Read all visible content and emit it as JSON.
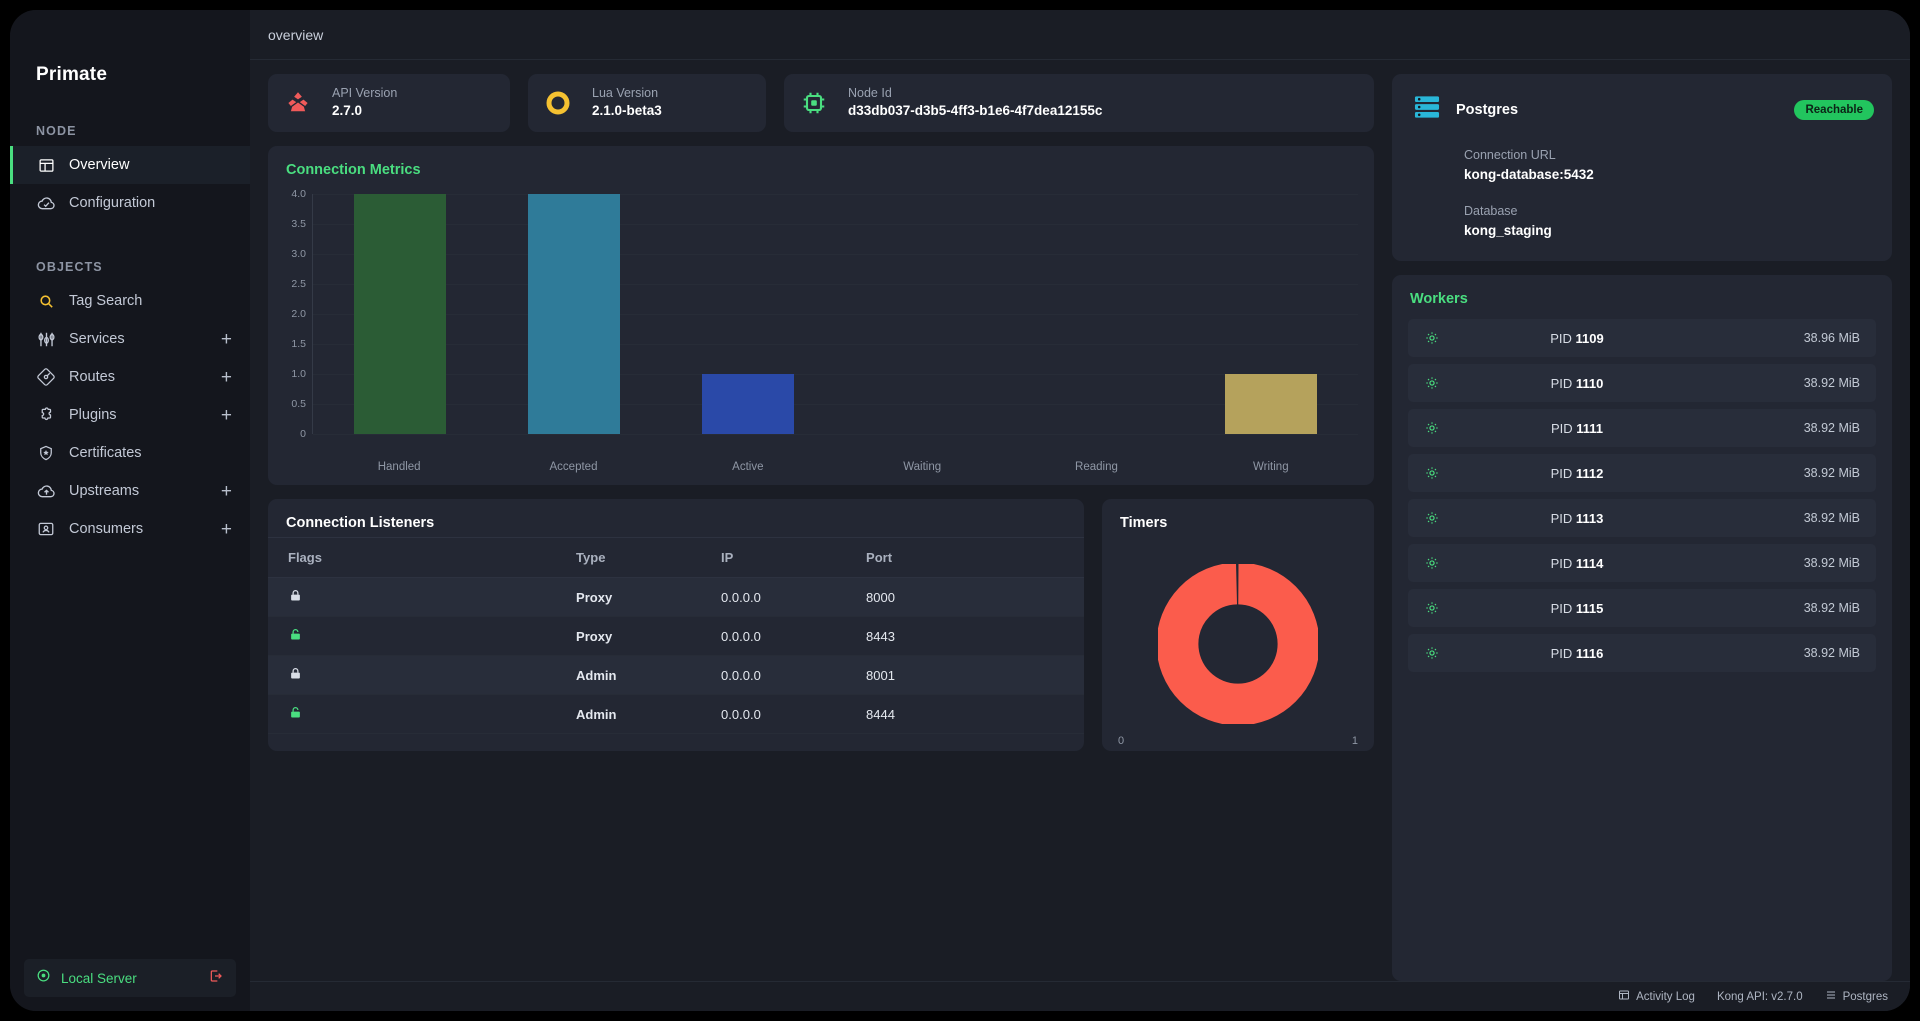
{
  "brand": "Primate",
  "sidebar": {
    "sections": [
      {
        "label": "NODE",
        "items": [
          {
            "label": "Overview",
            "icon": "dashboard-icon",
            "active": true,
            "plus": false
          },
          {
            "label": "Configuration",
            "icon": "cloud-check-icon",
            "active": false,
            "plus": false
          }
        ]
      },
      {
        "label": "OBJECTS",
        "items": [
          {
            "label": "Tag Search",
            "icon": "search-icon",
            "active": false,
            "plus": false
          },
          {
            "label": "Services",
            "icon": "sliders-icon",
            "active": false,
            "plus": true
          },
          {
            "label": "Routes",
            "icon": "route-diamond-icon",
            "active": false,
            "plus": true
          },
          {
            "label": "Plugins",
            "icon": "puzzle-icon",
            "active": false,
            "plus": true
          },
          {
            "label": "Certificates",
            "icon": "shield-star-icon",
            "active": false,
            "plus": false
          },
          {
            "label": "Upstreams",
            "icon": "cloud-upload-icon",
            "active": false,
            "plus": true
          },
          {
            "label": "Consumers",
            "icon": "user-card-icon",
            "active": false,
            "plus": true
          }
        ]
      }
    ],
    "footer": {
      "label": "Local Server",
      "icon": "server-status-icon",
      "logout_icon": "logout-icon"
    }
  },
  "breadcrumb": "overview",
  "info_cards": [
    {
      "label": "API Version",
      "value": "2.7.0",
      "icon": "kong-logo-icon",
      "color": "#f05a5a"
    },
    {
      "label": "Lua Version",
      "value": "2.1.0-beta3",
      "icon": "lua-logo-icon",
      "color": "#f5c131"
    },
    {
      "label": "Node Id",
      "value": "d33db037-d3b5-4ff3-b1e6-4f7dea12155c",
      "icon": "cpu-chip-icon",
      "color": "#4ade80"
    }
  ],
  "chart_data": {
    "type": "bar",
    "title": "Connection Metrics",
    "categories": [
      "Handled",
      "Accepted",
      "Active",
      "Waiting",
      "Reading",
      "Writing"
    ],
    "values": [
      4,
      4,
      1,
      0,
      0,
      1
    ],
    "colors": [
      "#2b5c35",
      "#2f7b99",
      "#2a49a8",
      "#b5a25c",
      "#b5a25c",
      "#b5a25c"
    ],
    "bar_colors": [
      "#2b5c35",
      "#2f7b99",
      "#2a49a8",
      "#2a49a8",
      "#b5a25c",
      "#b5a25c"
    ],
    "ylim": [
      0,
      4
    ],
    "yticks": [
      "4.0",
      "3.5",
      "3.0",
      "2.5",
      "2.0",
      "1.5",
      "1.0",
      "0.5",
      "0"
    ],
    "xlabel": "",
    "ylabel": "",
    "grid": true,
    "legend": "none"
  },
  "listeners": {
    "title": "Connection Listeners",
    "columns": [
      "Flags",
      "Type",
      "IP",
      "Port"
    ],
    "rows": [
      {
        "flag_icon": "lock-closed-icon",
        "flag_color": "#d9dee7",
        "type": "Proxy",
        "ip": "0.0.0.0",
        "port": "8000"
      },
      {
        "flag_icon": "lock-open-icon",
        "flag_color": "#4ade80",
        "type": "Proxy",
        "ip": "0.0.0.0",
        "port": "8443"
      },
      {
        "flag_icon": "lock-closed-icon",
        "flag_color": "#d9dee7",
        "type": "Admin",
        "ip": "0.0.0.0",
        "port": "8001"
      },
      {
        "flag_icon": "lock-open-icon",
        "flag_color": "#4ade80",
        "type": "Admin",
        "ip": "0.0.0.0",
        "port": "8444"
      }
    ]
  },
  "timers": {
    "title": "Timers",
    "chart": {
      "type": "pie",
      "values": [
        1,
        0
      ],
      "colors": [
        "#fb5c4c",
        "#232733"
      ],
      "labels": [
        "0",
        "1"
      ]
    },
    "left_label": "0",
    "right_label": "1"
  },
  "postgres": {
    "name": "Postgres",
    "icon": "database-icon",
    "status": "Reachable",
    "status_color": "#22c55e",
    "fields": [
      {
        "key": "Connection URL",
        "value": "kong-database:5432"
      },
      {
        "key": "Database",
        "value": "kong_staging"
      }
    ]
  },
  "workers": {
    "title": "Workers",
    "rows": [
      {
        "icon": "gear-cog-icon",
        "prefix": "PID",
        "pid": "1109",
        "memory": "38.96 MiB"
      },
      {
        "icon": "gear-cog-icon",
        "prefix": "PID",
        "pid": "1110",
        "memory": "38.92 MiB"
      },
      {
        "icon": "gear-cog-icon",
        "prefix": "PID",
        "pid": "1111",
        "memory": "38.92 MiB"
      },
      {
        "icon": "gear-cog-icon",
        "prefix": "PID",
        "pid": "1112",
        "memory": "38.92 MiB"
      },
      {
        "icon": "gear-cog-icon",
        "prefix": "PID",
        "pid": "1113",
        "memory": "38.92 MiB"
      },
      {
        "icon": "gear-cog-icon",
        "prefix": "PID",
        "pid": "1114",
        "memory": "38.92 MiB"
      },
      {
        "icon": "gear-cog-icon",
        "prefix": "PID",
        "pid": "1115",
        "memory": "38.92 MiB"
      },
      {
        "icon": "gear-cog-icon",
        "prefix": "PID",
        "pid": "1116",
        "memory": "38.92 MiB"
      }
    ]
  },
  "statusbar": [
    {
      "icon": "activity-log-icon",
      "label": "Activity Log"
    },
    {
      "icon": "",
      "label": "Kong API: v2.7.0"
    },
    {
      "icon": "database-small-icon",
      "label": "Postgres"
    }
  ]
}
